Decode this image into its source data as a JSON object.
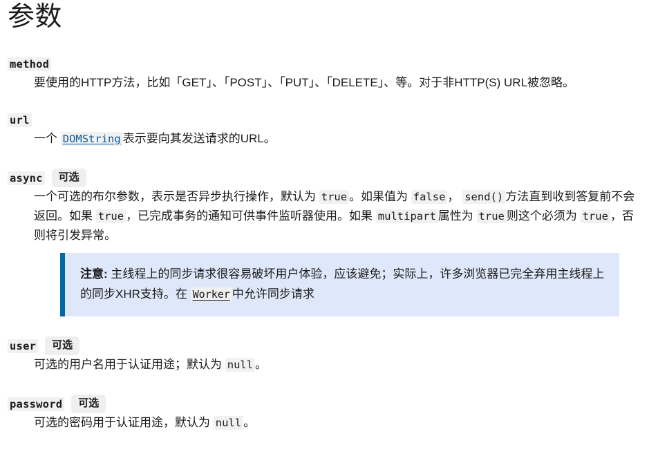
{
  "page": {
    "title": "参数"
  },
  "params": [
    {
      "name": "method",
      "optional_label": null,
      "description_parts": [
        {
          "type": "text",
          "value": "要使用的HTTP方法，比如「GET」、「POST」、「PUT」、「DELETE」、等。对于非HTTP(S) URL被忽略。"
        }
      ],
      "description_plain": "要使用的HTTP方法，比如「GET」、「POST」、「PUT」、「DELETE」、等。对于非HTTP(S) URL被忽略。"
    },
    {
      "name": "url",
      "optional_label": null,
      "description_plain": "一个 DOMString 表示要向其发送请求的URL。",
      "pre_link_text": "一个",
      "link_text": "DOMString",
      "post_link_text": "表示要向其发送请求的URL。"
    },
    {
      "name": "async",
      "optional_label": "可选",
      "description_plain": "一个可选的布尔参数，表示是否异步执行操作，默认为 true。如果值为 false，send() 方法直到收到答复前不会返回。如果 true，已完成事务的通知可供事件监听器使用。如果 multipart 属性为 true 则这个必须为 true，否则将引发异常。",
      "segments": [
        {
          "type": "text",
          "value": "一个可选的布尔参数，表示是否异步执行操作，默认为"
        },
        {
          "type": "code",
          "value": "true"
        },
        {
          "type": "text",
          "value": "。如果值为"
        },
        {
          "type": "code",
          "value": "false"
        },
        {
          "type": "text",
          "value": "，"
        },
        {
          "type": "code",
          "value": "send()"
        },
        {
          "type": "text",
          "value": "方法直到收到答复前不会返回。如果"
        },
        {
          "type": "code",
          "value": "true"
        },
        {
          "type": "text",
          "value": "，已完成事务的通知可供事件监听器使用。如果"
        },
        {
          "type": "code",
          "value": "multipart"
        },
        {
          "type": "text",
          "value": "属性为"
        },
        {
          "type": "code",
          "value": "true"
        },
        {
          "type": "text",
          "value": "则这个必须为"
        },
        {
          "type": "code",
          "value": "true"
        },
        {
          "type": "text",
          "value": "，否则将引发异常。"
        }
      ],
      "note": {
        "label": "注意:",
        "text_before_link": "主线程上的同步请求很容易破坏用户体验，应该避免；实际上，许多浏览器已完全弃用主线程上的同步XHR支持。在",
        "link_text": "Worker",
        "text_after_link": "中允许同步请求"
      }
    },
    {
      "name": "user",
      "optional_label": "可选",
      "description_plain": "可选的用户名用于认证用途；默认为 null。",
      "pre_code_text": "可选的用户名用于认证用途；默认为",
      "code_text": "null",
      "post_code_text": "。"
    },
    {
      "name": "password",
      "optional_label": "可选",
      "description_plain": "可选的密码用于认证用途，默认为 null。",
      "pre_code_text": "可选的密码用于认证用途，默认为",
      "code_text": "null",
      "post_code_text": "。"
    }
  ],
  "colors": {
    "background": "#ffffff",
    "text": "#1b1b1b",
    "code_background": "#f2f1f1",
    "badge_background": "#f0efef",
    "link": "#0b5a9e",
    "note_background": "#dfe8fa",
    "note_border": "#0069a6"
  }
}
